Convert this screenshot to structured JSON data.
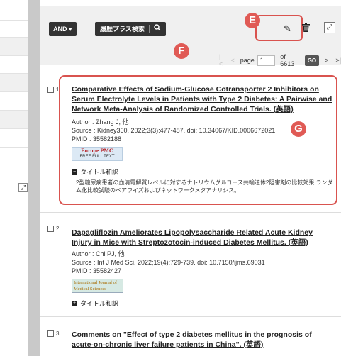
{
  "toolbar": {
    "and_label": "AND",
    "history_label": "履歴プラス検索",
    "search_icon": "search-icon",
    "pencil_icon": "pencil-icon",
    "trash_icon": "trash-icon",
    "fullscreen_icon": "fullscreen-icon"
  },
  "markers": {
    "e": "E",
    "f": "F",
    "g": "G"
  },
  "pager": {
    "first": "|<",
    "prev": "<",
    "page_label": "page",
    "page_value": "1",
    "of_label": "of 6613",
    "go_label": "GO",
    "next": ">",
    "last": ">|"
  },
  "results": [
    {
      "num": "1",
      "title": "Comparative Effects of Sodium-Glucose Cotransporter 2 Inhibitors on Serum Electrolyte Levels in Patients with Type 2 Diabetes: A Pairwise and Network Meta-Analysis of Randomized Controlled Trials. (英語)",
      "author": "Author : Zhang J, 他",
      "source": "Source : Kidney360. 2022;3(3):477-487. doi: 10.34067/KID.0006672021",
      "pmid": "PMID : 35582188",
      "badge_line1": "Europe PMC",
      "badge_line2": "FREE FULL TEXT",
      "trans_label": "タイトル和訳",
      "trans_text": "2型糖尿病患者の血清電解質レベルに対するナトリウムグルコース共輸送体2阻害剤の比較効果:ランダム化比較試験のペアワイズおよびネットワークメタアナリシス。"
    },
    {
      "num": "2",
      "title": "Dapagliflozin Ameliorates Lipopolysaccharide Related Acute Kidney Injury in Mice with Streptozotocin-induced Diabetes Mellitus. (英語)",
      "author": "Author : Chi PJ, 他",
      "source": "Source : Int J Med Sci. 2022;19(4):729-739. doi: 10.7150/ijms.69031",
      "pmid": "PMID : 35582427",
      "badge_line1": "International Journal of",
      "badge_line2": "Medical Sciences",
      "trans_label": "タイトル和訳"
    },
    {
      "num": "3",
      "title": "Comments on \"Effect of type 2 diabetes mellitus in the prognosis of acute-on-chronic liver failure patients in China\". (英語)"
    }
  ]
}
